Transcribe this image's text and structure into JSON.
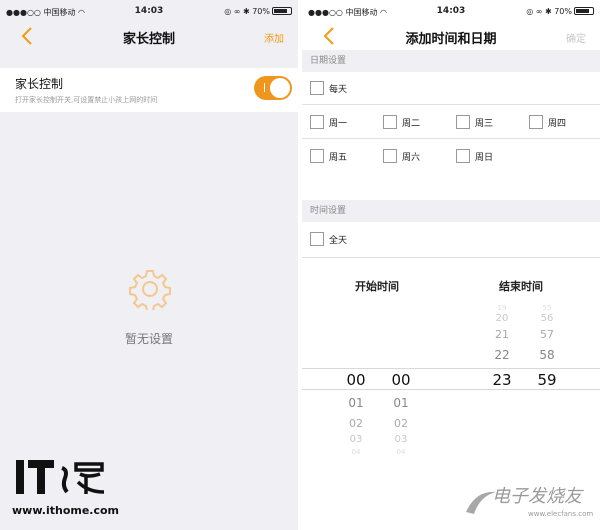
{
  "status_bar": {
    "carrier": "●●●○○ 中国移动 ◠",
    "time": "14:03",
    "battery": "◎ ∞ ✱ 70%"
  },
  "left_screen": {
    "nav_title": "家长控制",
    "nav_action": "添加",
    "setting_title": "家长控制",
    "setting_desc": "打开家长控制开关,可设置禁止小孩上网的时间",
    "toggle_on": true,
    "toggle_color": "#f0961e",
    "empty_icon": "gear-icon",
    "empty_text": "暂无设置"
  },
  "right_screen": {
    "nav_title": "添加时间和日期",
    "nav_action": "确定",
    "date_section": "日期设置",
    "every_day": "每天",
    "weekdays": [
      "周一",
      "周二",
      "周三",
      "周四",
      "周五",
      "周六",
      "周日"
    ],
    "time_section": "时间设置",
    "all_day": "全天",
    "start_label": "开始时间",
    "end_label": "结束时间",
    "start_hours": [
      "00",
      "01",
      "02",
      "03",
      "04"
    ],
    "start_minutes": [
      "00",
      "01",
      "02",
      "03",
      "04"
    ],
    "end_hours": [
      "19",
      "20",
      "21",
      "22",
      "23"
    ],
    "end_minutes": [
      "55",
      "56",
      "57",
      "58",
      "59"
    ]
  },
  "accent_color": "#f39c12",
  "logo": {
    "mark_text": "IT之家",
    "url": "www.ithome.com"
  },
  "watermark": {
    "text": "电子发烧友",
    "url": "www.elecfans.com"
  }
}
